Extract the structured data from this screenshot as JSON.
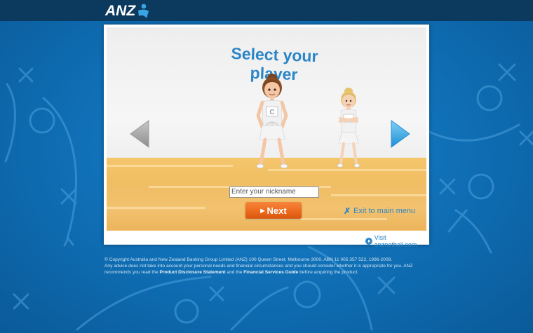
{
  "header": {
    "logo_text": "ANZ"
  },
  "screen": {
    "title": "Select your player",
    "nickname_placeholder": "Enter your nickname",
    "next_label": "Next",
    "exit_label": "Exit to main menu",
    "visit_label": "Visit anznetball.com",
    "player_bib": "C"
  },
  "footer": {
    "line1": "© Copyright Australia and New Zealand Banking Group Limited (ANZ) 100 Queen Street, Melbourne 3000, ABN 11 005 357 522, 1996-2009.",
    "line2_pre": "Any advice does not take into account your personal needs and financial circumstances and you should consider whether it is appropriate for you. ANZ recommends you read the ",
    "pds_link": "Product Disclosure Statement",
    "line2_mid": " and the ",
    "fsg_link": "Financial Services Guide",
    "line2_post": " before acquiring the product."
  },
  "colors": {
    "brand_blue": "#2b86c6",
    "header_navy": "#0c3a5e",
    "next_orange": "#ec6a1d",
    "arrow_blue": "#3da8e6",
    "arrow_grey": "#a8a8a8"
  },
  "icons": {
    "logo": "anz-person-icon",
    "prev": "arrow-left-icon",
    "next": "arrow-right-icon",
    "exit": "close-icon",
    "visit": "play-circle-icon"
  }
}
